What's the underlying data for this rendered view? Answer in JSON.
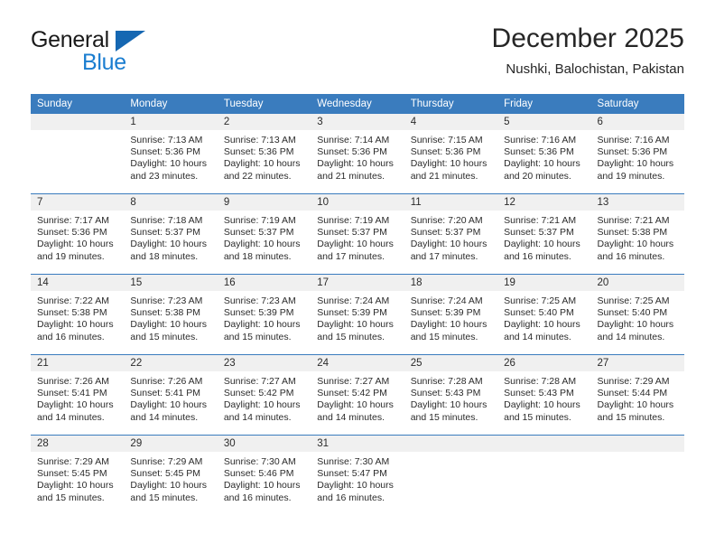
{
  "brand": {
    "name_part1": "General",
    "name_part2": "Blue",
    "triangle_color": "#1567b2",
    "blue_color": "#1a7dd0"
  },
  "header": {
    "month_title": "December 2025",
    "location": "Nushki, Balochistan, Pakistan"
  },
  "calendar": {
    "header_bg": "#3a7cbe",
    "daynum_bg": "#f0f0f0",
    "weekday_headers": [
      "Sunday",
      "Monday",
      "Tuesday",
      "Wednesday",
      "Thursday",
      "Friday",
      "Saturday"
    ],
    "weeks": [
      [
        {
          "day": "",
          "sunrise": "",
          "sunset": "",
          "daylight1": "",
          "daylight2": ""
        },
        {
          "day": "1",
          "sunrise": "Sunrise: 7:13 AM",
          "sunset": "Sunset: 5:36 PM",
          "daylight1": "Daylight: 10 hours",
          "daylight2": "and 23 minutes."
        },
        {
          "day": "2",
          "sunrise": "Sunrise: 7:13 AM",
          "sunset": "Sunset: 5:36 PM",
          "daylight1": "Daylight: 10 hours",
          "daylight2": "and 22 minutes."
        },
        {
          "day": "3",
          "sunrise": "Sunrise: 7:14 AM",
          "sunset": "Sunset: 5:36 PM",
          "daylight1": "Daylight: 10 hours",
          "daylight2": "and 21 minutes."
        },
        {
          "day": "4",
          "sunrise": "Sunrise: 7:15 AM",
          "sunset": "Sunset: 5:36 PM",
          "daylight1": "Daylight: 10 hours",
          "daylight2": "and 21 minutes."
        },
        {
          "day": "5",
          "sunrise": "Sunrise: 7:16 AM",
          "sunset": "Sunset: 5:36 PM",
          "daylight1": "Daylight: 10 hours",
          "daylight2": "and 20 minutes."
        },
        {
          "day": "6",
          "sunrise": "Sunrise: 7:16 AM",
          "sunset": "Sunset: 5:36 PM",
          "daylight1": "Daylight: 10 hours",
          "daylight2": "and 19 minutes."
        }
      ],
      [
        {
          "day": "7",
          "sunrise": "Sunrise: 7:17 AM",
          "sunset": "Sunset: 5:36 PM",
          "daylight1": "Daylight: 10 hours",
          "daylight2": "and 19 minutes."
        },
        {
          "day": "8",
          "sunrise": "Sunrise: 7:18 AM",
          "sunset": "Sunset: 5:37 PM",
          "daylight1": "Daylight: 10 hours",
          "daylight2": "and 18 minutes."
        },
        {
          "day": "9",
          "sunrise": "Sunrise: 7:19 AM",
          "sunset": "Sunset: 5:37 PM",
          "daylight1": "Daylight: 10 hours",
          "daylight2": "and 18 minutes."
        },
        {
          "day": "10",
          "sunrise": "Sunrise: 7:19 AM",
          "sunset": "Sunset: 5:37 PM",
          "daylight1": "Daylight: 10 hours",
          "daylight2": "and 17 minutes."
        },
        {
          "day": "11",
          "sunrise": "Sunrise: 7:20 AM",
          "sunset": "Sunset: 5:37 PM",
          "daylight1": "Daylight: 10 hours",
          "daylight2": "and 17 minutes."
        },
        {
          "day": "12",
          "sunrise": "Sunrise: 7:21 AM",
          "sunset": "Sunset: 5:37 PM",
          "daylight1": "Daylight: 10 hours",
          "daylight2": "and 16 minutes."
        },
        {
          "day": "13",
          "sunrise": "Sunrise: 7:21 AM",
          "sunset": "Sunset: 5:38 PM",
          "daylight1": "Daylight: 10 hours",
          "daylight2": "and 16 minutes."
        }
      ],
      [
        {
          "day": "14",
          "sunrise": "Sunrise: 7:22 AM",
          "sunset": "Sunset: 5:38 PM",
          "daylight1": "Daylight: 10 hours",
          "daylight2": "and 16 minutes."
        },
        {
          "day": "15",
          "sunrise": "Sunrise: 7:23 AM",
          "sunset": "Sunset: 5:38 PM",
          "daylight1": "Daylight: 10 hours",
          "daylight2": "and 15 minutes."
        },
        {
          "day": "16",
          "sunrise": "Sunrise: 7:23 AM",
          "sunset": "Sunset: 5:39 PM",
          "daylight1": "Daylight: 10 hours",
          "daylight2": "and 15 minutes."
        },
        {
          "day": "17",
          "sunrise": "Sunrise: 7:24 AM",
          "sunset": "Sunset: 5:39 PM",
          "daylight1": "Daylight: 10 hours",
          "daylight2": "and 15 minutes."
        },
        {
          "day": "18",
          "sunrise": "Sunrise: 7:24 AM",
          "sunset": "Sunset: 5:39 PM",
          "daylight1": "Daylight: 10 hours",
          "daylight2": "and 15 minutes."
        },
        {
          "day": "19",
          "sunrise": "Sunrise: 7:25 AM",
          "sunset": "Sunset: 5:40 PM",
          "daylight1": "Daylight: 10 hours",
          "daylight2": "and 14 minutes."
        },
        {
          "day": "20",
          "sunrise": "Sunrise: 7:25 AM",
          "sunset": "Sunset: 5:40 PM",
          "daylight1": "Daylight: 10 hours",
          "daylight2": "and 14 minutes."
        }
      ],
      [
        {
          "day": "21",
          "sunrise": "Sunrise: 7:26 AM",
          "sunset": "Sunset: 5:41 PM",
          "daylight1": "Daylight: 10 hours",
          "daylight2": "and 14 minutes."
        },
        {
          "day": "22",
          "sunrise": "Sunrise: 7:26 AM",
          "sunset": "Sunset: 5:41 PM",
          "daylight1": "Daylight: 10 hours",
          "daylight2": "and 14 minutes."
        },
        {
          "day": "23",
          "sunrise": "Sunrise: 7:27 AM",
          "sunset": "Sunset: 5:42 PM",
          "daylight1": "Daylight: 10 hours",
          "daylight2": "and 14 minutes."
        },
        {
          "day": "24",
          "sunrise": "Sunrise: 7:27 AM",
          "sunset": "Sunset: 5:42 PM",
          "daylight1": "Daylight: 10 hours",
          "daylight2": "and 14 minutes."
        },
        {
          "day": "25",
          "sunrise": "Sunrise: 7:28 AM",
          "sunset": "Sunset: 5:43 PM",
          "daylight1": "Daylight: 10 hours",
          "daylight2": "and 15 minutes."
        },
        {
          "day": "26",
          "sunrise": "Sunrise: 7:28 AM",
          "sunset": "Sunset: 5:43 PM",
          "daylight1": "Daylight: 10 hours",
          "daylight2": "and 15 minutes."
        },
        {
          "day": "27",
          "sunrise": "Sunrise: 7:29 AM",
          "sunset": "Sunset: 5:44 PM",
          "daylight1": "Daylight: 10 hours",
          "daylight2": "and 15 minutes."
        }
      ],
      [
        {
          "day": "28",
          "sunrise": "Sunrise: 7:29 AM",
          "sunset": "Sunset: 5:45 PM",
          "daylight1": "Daylight: 10 hours",
          "daylight2": "and 15 minutes."
        },
        {
          "day": "29",
          "sunrise": "Sunrise: 7:29 AM",
          "sunset": "Sunset: 5:45 PM",
          "daylight1": "Daylight: 10 hours",
          "daylight2": "and 15 minutes."
        },
        {
          "day": "30",
          "sunrise": "Sunrise: 7:30 AM",
          "sunset": "Sunset: 5:46 PM",
          "daylight1": "Daylight: 10 hours",
          "daylight2": "and 16 minutes."
        },
        {
          "day": "31",
          "sunrise": "Sunrise: 7:30 AM",
          "sunset": "Sunset: 5:47 PM",
          "daylight1": "Daylight: 10 hours",
          "daylight2": "and 16 minutes."
        },
        {
          "day": "",
          "sunrise": "",
          "sunset": "",
          "daylight1": "",
          "daylight2": ""
        },
        {
          "day": "",
          "sunrise": "",
          "sunset": "",
          "daylight1": "",
          "daylight2": ""
        },
        {
          "day": "",
          "sunrise": "",
          "sunset": "",
          "daylight1": "",
          "daylight2": ""
        }
      ]
    ]
  }
}
